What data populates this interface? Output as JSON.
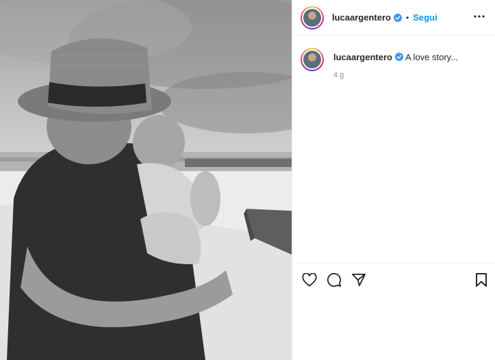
{
  "post": {
    "image_alt": "Black and white photo of a man in a straw hat hugging a child on a beach",
    "username": "lucaargentero",
    "verified": true,
    "follow_label": "Segui",
    "separator": "•",
    "caption": "A love story...",
    "time_ago": "4 g"
  },
  "icons": {
    "more": "more-horizontal-icon",
    "like": "heart-icon",
    "comment": "comment-icon",
    "share": "share-paper-plane-icon",
    "save": "bookmark-icon",
    "verified": "verified-badge-icon"
  },
  "colors": {
    "link_blue": "#0095f6",
    "verified_blue": "#3897f0",
    "text_dark": "#262626",
    "text_muted": "#8e8e8e",
    "divider": "#efefef"
  }
}
